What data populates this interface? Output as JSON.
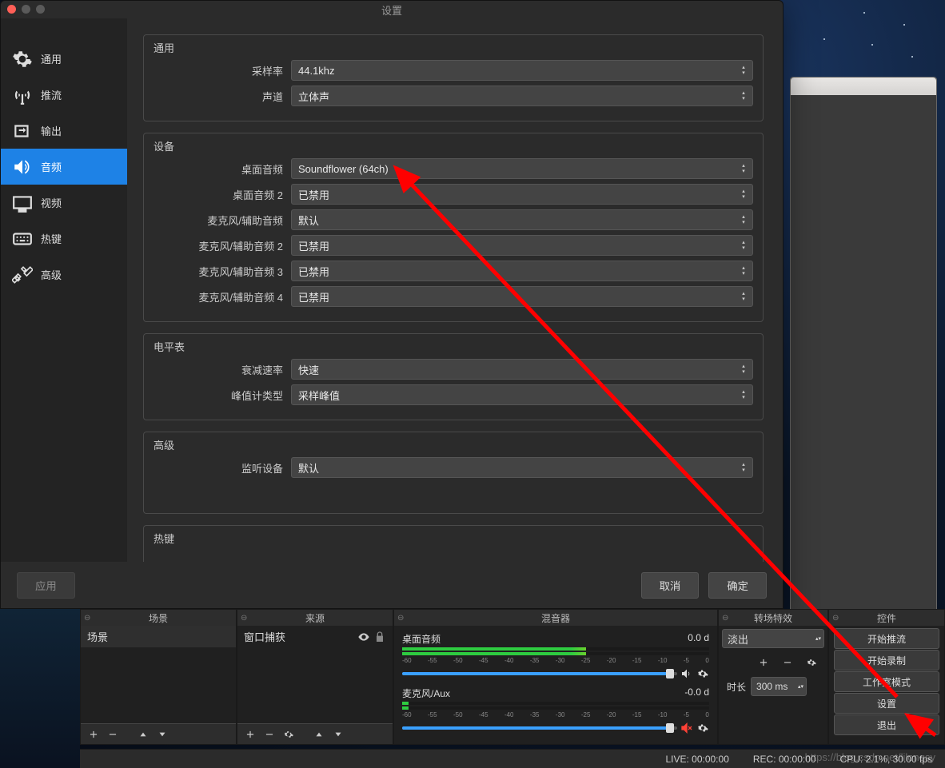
{
  "dialog": {
    "title": "设置",
    "sidebar": [
      {
        "icon": "gear",
        "label": "通用"
      },
      {
        "icon": "stream",
        "label": "推流"
      },
      {
        "icon": "output",
        "label": "输出"
      },
      {
        "icon": "audio",
        "label": "音频"
      },
      {
        "icon": "video",
        "label": "视频"
      },
      {
        "icon": "hotkeys",
        "label": "热键"
      },
      {
        "icon": "advanced",
        "label": "高级"
      }
    ],
    "groups": {
      "general": {
        "title": "通用",
        "rows": [
          {
            "label": "采样率",
            "value": "44.1khz"
          },
          {
            "label": "声道",
            "value": "立体声"
          }
        ]
      },
      "devices": {
        "title": "设备",
        "rows": [
          {
            "label": "桌面音频",
            "value": "Soundflower (64ch)"
          },
          {
            "label": "桌面音频 2",
            "value": "已禁用"
          },
          {
            "label": "麦克风/辅助音频",
            "value": "默认"
          },
          {
            "label": "麦克风/辅助音频 2",
            "value": "已禁用"
          },
          {
            "label": "麦克风/辅助音频 3",
            "value": "已禁用"
          },
          {
            "label": "麦克风/辅助音频 4",
            "value": "已禁用"
          }
        ]
      },
      "meters": {
        "title": "电平表",
        "rows": [
          {
            "label": "衰减速率",
            "value": "快速"
          },
          {
            "label": "峰值计类型",
            "value": "采样峰值"
          }
        ]
      },
      "advanced": {
        "title": "高级",
        "rows": [
          {
            "label": "监听设备",
            "value": "默认"
          }
        ]
      },
      "hotkeys": {
        "title": "热键"
      }
    },
    "buttons": {
      "apply": "应用",
      "cancel": "取消",
      "ok": "确定"
    }
  },
  "docks": {
    "scenes": {
      "title": "场景",
      "item": "场景"
    },
    "sources": {
      "title": "来源",
      "item": "窗口捕获"
    },
    "mixer": {
      "title": "混音器",
      "ch1": {
        "name": "桌面音频",
        "db": "0.0 d"
      },
      "ch2": {
        "name": "麦克风/Aux",
        "db": "-0.0 d"
      },
      "ticks": [
        "-60",
        "-55",
        "-50",
        "-45",
        "-40",
        "-35",
        "-30",
        "-25",
        "-20",
        "-15",
        "-10",
        "-5",
        "0"
      ]
    },
    "transitions": {
      "title": "转场特效",
      "value": "淡出",
      "duration_label": "时长",
      "duration": "300 ms"
    },
    "controls": {
      "title": "控件",
      "buttons": [
        "开始推流",
        "开始录制",
        "工作室模式",
        "设置",
        "退出"
      ]
    }
  },
  "status": {
    "live": "LIVE: 00:00:00",
    "rec": "REC: 00:00:00",
    "cpu": "CPU: 2.1%, 30.00 fps"
  },
  "watermark": "https://blog.csdn.net/lilongsy"
}
